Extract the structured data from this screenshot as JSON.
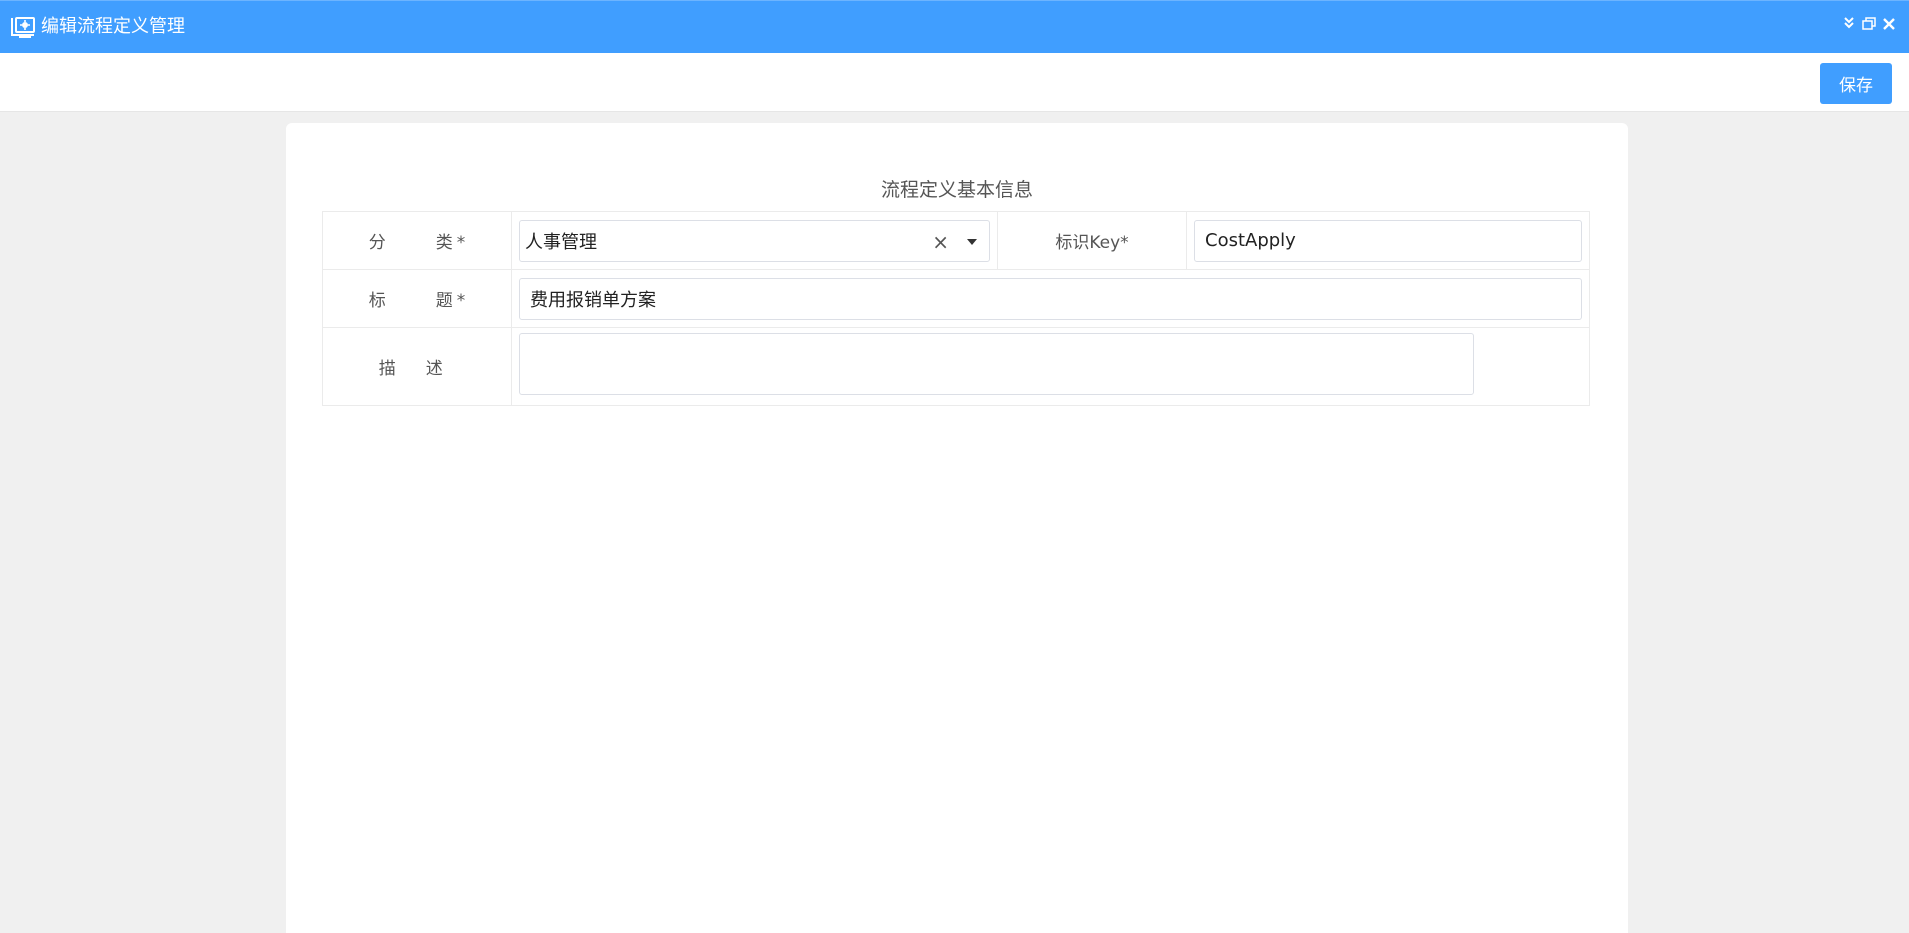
{
  "window": {
    "title": "编辑流程定义管理",
    "icons": [
      "settings-monitor-icon",
      "collapse-icon",
      "restore-icon",
      "close-icon"
    ]
  },
  "toolbar": {
    "save_label": "保存"
  },
  "form": {
    "section_title": "流程定义基本信息",
    "category": {
      "label": "分类",
      "required": "*",
      "value": "人事管理",
      "clear": "×"
    },
    "key": {
      "label": "标识Key",
      "required": "*",
      "value": "CostApply"
    },
    "title": {
      "label": "标题",
      "required": "*",
      "value": "费用报销单方案"
    },
    "description": {
      "label": "描述",
      "value": ""
    }
  },
  "colors": {
    "primary": "#409eff",
    "background": "#f0f0f0",
    "card": "#ffffff",
    "border": "#dcdfe6"
  }
}
